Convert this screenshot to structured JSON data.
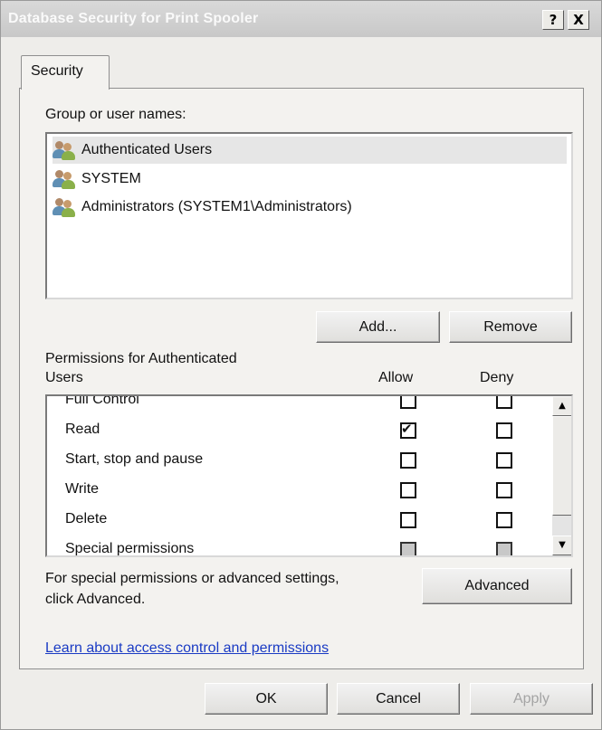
{
  "window": {
    "title": "Database Security for Print Spooler",
    "help_label": "?",
    "close_label": "X"
  },
  "tabs": [
    {
      "label": "Security",
      "selected": true
    }
  ],
  "security": {
    "group_label": "Group or user names:",
    "users": [
      {
        "name": "Authenticated Users",
        "selected": true,
        "icon": "users-icon"
      },
      {
        "name": "SYSTEM",
        "selected": false,
        "icon": "users-icon"
      },
      {
        "name": "Administrators (SYSTEM1\\Administrators)",
        "selected": false,
        "icon": "users-icon"
      }
    ],
    "add_label": "Add...",
    "remove_label": "Remove",
    "perm_label_line1": "Permissions for Authenticated",
    "perm_label_line2": "Users",
    "allow_header": "Allow",
    "deny_header": "Deny",
    "permissions": [
      {
        "name": "Full Control",
        "allow": false,
        "deny": false,
        "allow_gray": false,
        "deny_gray": false
      },
      {
        "name": "Read",
        "allow": true,
        "deny": false,
        "allow_gray": false,
        "deny_gray": false
      },
      {
        "name": "Start, stop and pause",
        "allow": false,
        "deny": false,
        "allow_gray": false,
        "deny_gray": false
      },
      {
        "name": "Write",
        "allow": false,
        "deny": false,
        "allow_gray": false,
        "deny_gray": false
      },
      {
        "name": "Delete",
        "allow": false,
        "deny": false,
        "allow_gray": false,
        "deny_gray": false
      },
      {
        "name": "Special permissions",
        "allow": false,
        "deny": false,
        "allow_gray": true,
        "deny_gray": true
      }
    ],
    "special_text_line1": "For special permissions or advanced settings,",
    "special_text_line2": "click Advanced.",
    "advanced_label": "Advanced",
    "learn_link": "Learn about access control and permissions"
  },
  "footer": {
    "ok_label": "OK",
    "cancel_label": "Cancel",
    "apply_label": "Apply"
  },
  "colors": {
    "link": "#1a3bc4",
    "dialog_bg": "#eeedea"
  }
}
